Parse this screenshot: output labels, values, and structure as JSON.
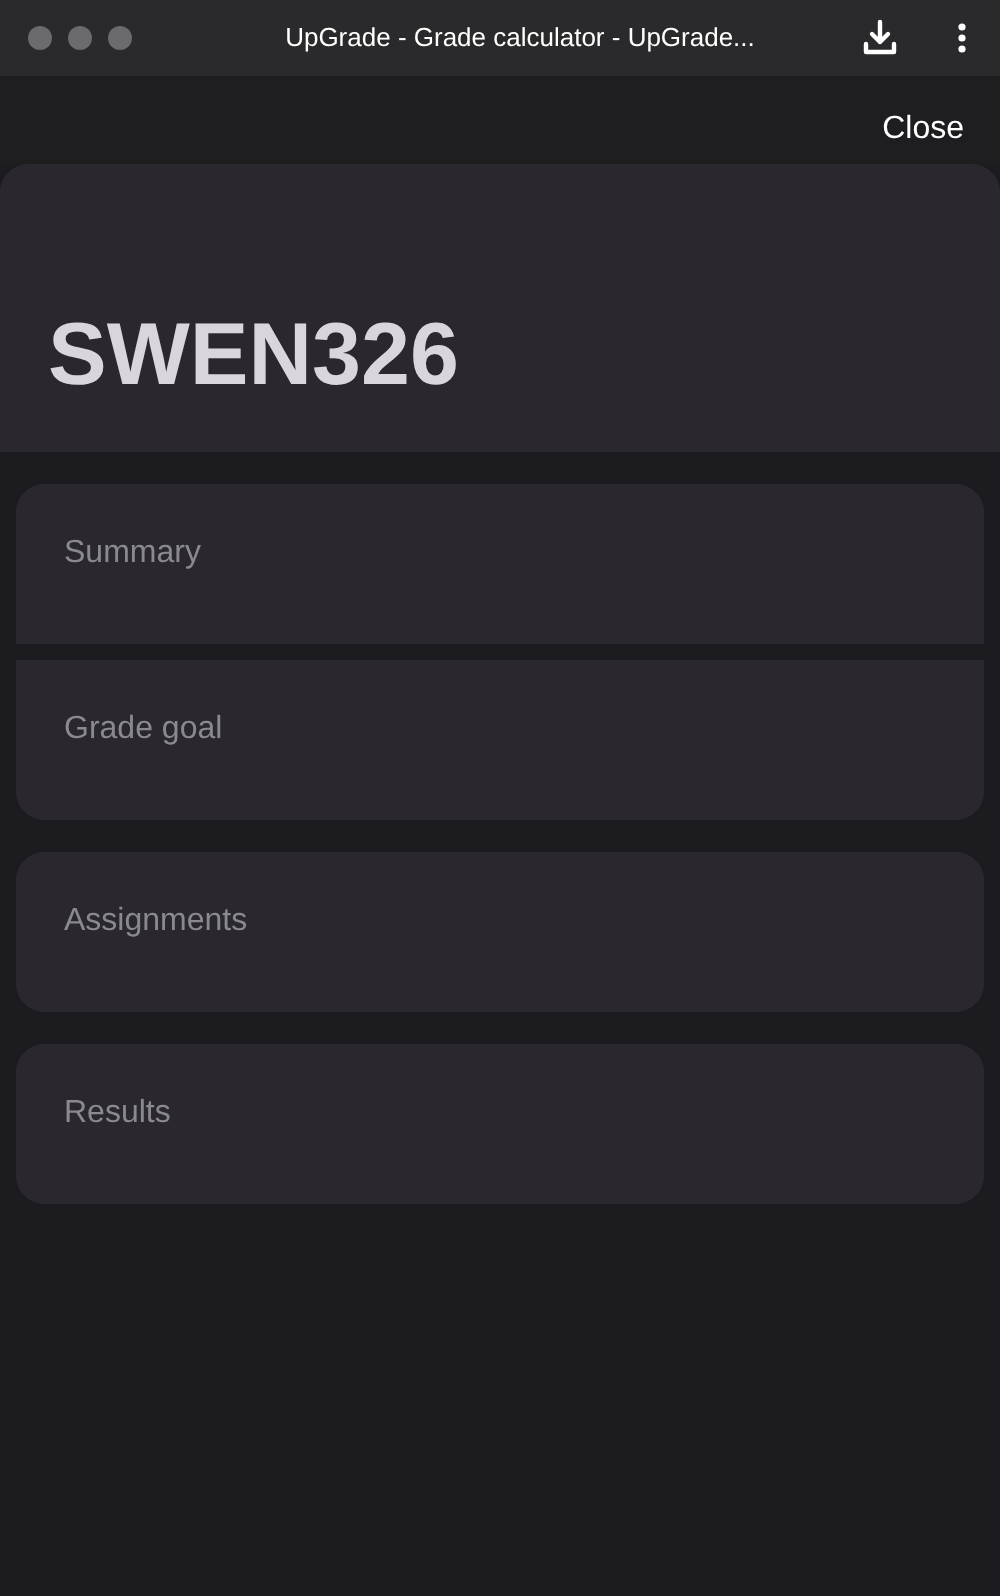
{
  "window": {
    "title": "UpGrade - Grade calculator - UpGrade..."
  },
  "close_button": "Close",
  "course": {
    "title": "SWEN326"
  },
  "groups": [
    {
      "items": [
        "Summary",
        "Grade goal"
      ]
    },
    {
      "items": [
        "Assignments"
      ]
    },
    {
      "items": [
        "Results"
      ]
    }
  ]
}
